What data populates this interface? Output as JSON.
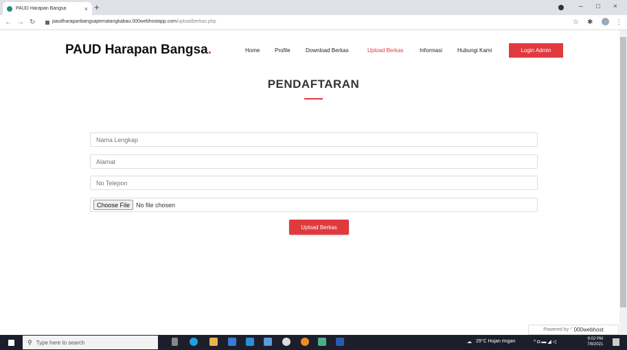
{
  "browser": {
    "tab_title": "PAUD Harapan Bangsa",
    "tab_close": "×",
    "new_tab": "+",
    "url_host": "paudharapanbangsapematangkabau.000webhostapp.com",
    "url_path": "/uploadberkas.php",
    "window_controls": [
      "–",
      "□",
      "×"
    ],
    "nav_icons": [
      "arrow-left-icon",
      "arrow-right-icon",
      "reload-icon"
    ]
  },
  "site": {
    "logo_text": "PAUD Harapan Bangsa",
    "logo_dot": ".",
    "accent_color": "#e03a3e",
    "nav": [
      "Home",
      "Profile",
      "Download Berkas",
      "Upload Berkas",
      "Informasi",
      "Hubungi Kami"
    ],
    "active_nav": "Upload Berkas",
    "login_button": "Login Admin"
  },
  "form": {
    "title": "PENDAFTARAN",
    "name_placeholder": "Nama Lengkap",
    "address_placeholder": "Alamat",
    "phone_placeholder": "No Telepon",
    "file_button": "Choose File",
    "file_status": "No file chosen",
    "submit_button": "Upload Berkas"
  },
  "footer": {
    "powered_by": "Powered by",
    "brand": "000webhost"
  },
  "taskbar": {
    "search_placeholder": "Type here to search",
    "weather": "29°C  Hujan ringan",
    "time": "9:02 PM",
    "date": "7/8/2021"
  }
}
